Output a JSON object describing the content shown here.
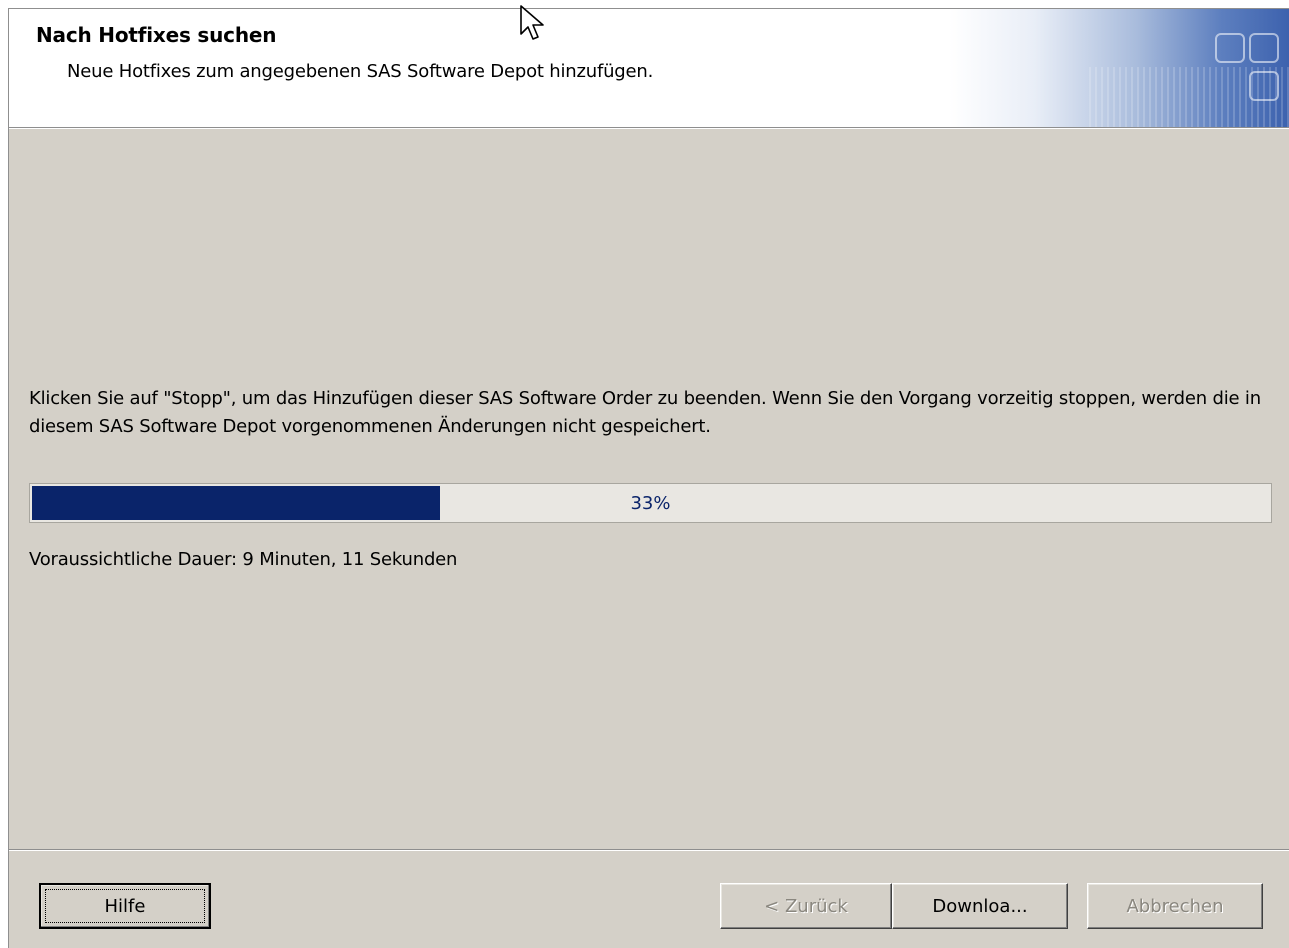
{
  "header": {
    "title": "Nach Hotfixes suchen",
    "subtitle": "Neue Hotfixes zum angegebenen SAS Software Depot hinzufügen."
  },
  "main": {
    "instruction": "Klicken Sie auf \"Stopp\", um das Hinzufügen dieser SAS Software Order zu beenden. Wenn Sie den Vorgang vorzeitig stoppen, werden die in diesem SAS Software Depot vorgenommenen Änderungen nicht gespeichert.",
    "progress": {
      "percent": 33,
      "label": "33%"
    },
    "duration": "Voraussichtliche Dauer: 9 Minuten, 11 Sekunden"
  },
  "footer": {
    "help_label": "Hilfe",
    "back_label": "< Zurück",
    "download_label": "Downloa...",
    "cancel_label": "Abbrechen"
  },
  "colors": {
    "progress_fill": "#0a246a",
    "dialog_bg": "#d4d0c8"
  },
  "icons": {
    "cursor": "mouse-pointer-icon"
  }
}
